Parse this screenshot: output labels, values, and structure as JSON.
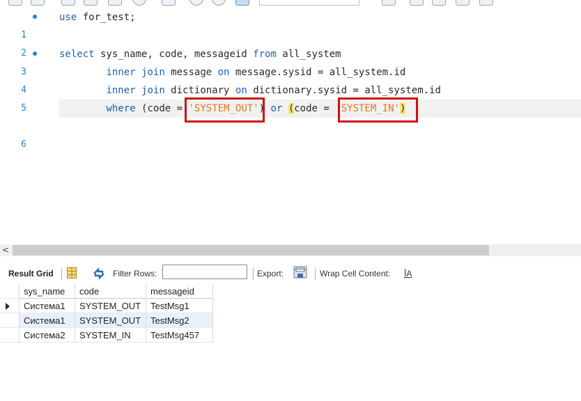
{
  "editor": {
    "lines": [
      {
        "num": "1",
        "marker": true
      },
      {
        "num": "2",
        "marker": false
      },
      {
        "num": "3",
        "marker": true
      },
      {
        "num": "4",
        "marker": false
      },
      {
        "num": "5",
        "marker": false
      },
      {
        "num": "6",
        "marker": false
      }
    ],
    "line1": {
      "kw_use": "use",
      "rest": " for_test;"
    },
    "line3": {
      "kw_select": "select",
      "cols": " sys_name, code, messageid ",
      "kw_from": "from",
      "table": " all_system"
    },
    "line4": {
      "indent": "        ",
      "kw_inner": "inner",
      "kw_join": "join",
      "table": " message ",
      "kw_on": "on",
      "cond": " message.sysid = all_system.id"
    },
    "line5": {
      "indent": "        ",
      "kw_inner": "inner",
      "kw_join": "join",
      "table": " dictionary ",
      "kw_on": "on",
      "cond": " dictionary.sysid = all_system.id"
    },
    "line6": {
      "indent": "        ",
      "kw_where": "where",
      "open1": "(",
      "code1": "code = ",
      "str1": "'SYSTEM_OUT'",
      "close1": ")",
      "kw_or": "or",
      "open2": "(",
      "code2": "code = ",
      "str2": "'SYSTEM_IN'",
      "close2": ")"
    }
  },
  "result_toolbar": {
    "result_grid_label": "Result Grid",
    "filter_rows_label": "Filter Rows:",
    "filter_value": "",
    "export_label": "Export:",
    "wrap_label": "Wrap Cell Content:",
    "wrap_icon_glyph": "ĪA"
  },
  "grid": {
    "columns": [
      "sys_name",
      "code",
      "messageid"
    ],
    "rows": [
      [
        "Система1",
        "SYSTEM_OUT",
        "TestMsg1"
      ],
      [
        "Система1",
        "SYSTEM_OUT",
        "TestMsg2"
      ],
      [
        "Система2",
        "SYSTEM_IN",
        "TestMsg457"
      ]
    ]
  },
  "colors": {
    "keyword": "#1f5fb4",
    "string": "#e07a1f",
    "line_number": "#2e82c7",
    "highlight_box": "#d01010",
    "paren_match": "#f4e96a"
  }
}
